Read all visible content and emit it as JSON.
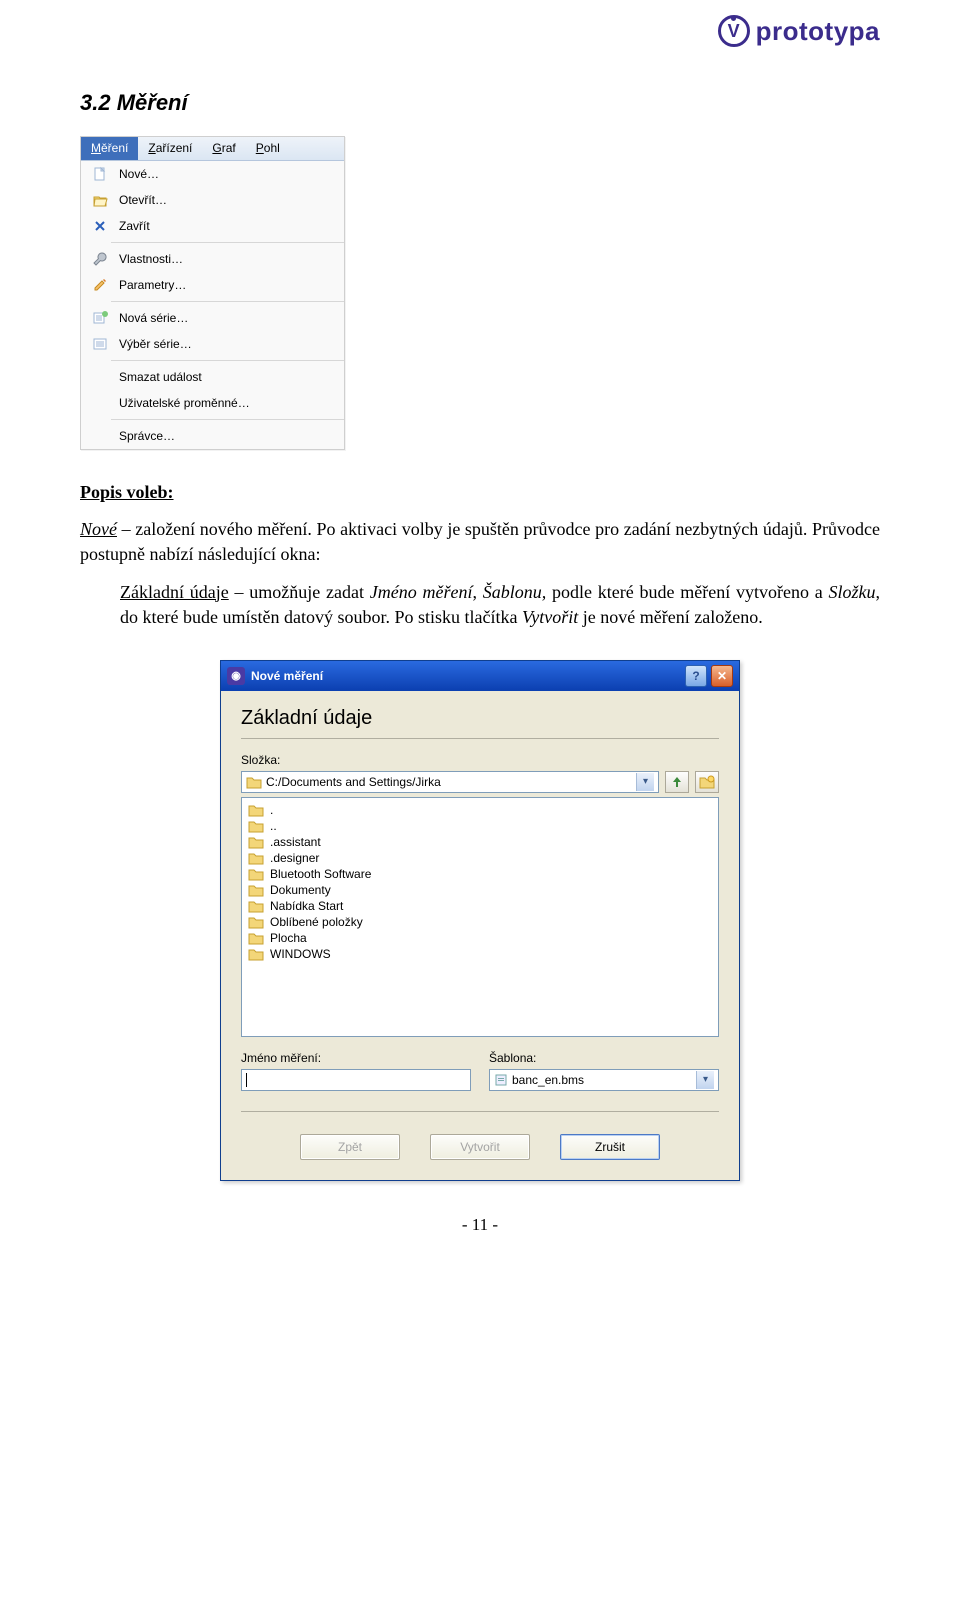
{
  "brand": {
    "name": "prototypa"
  },
  "section_heading": "3.2 Měření",
  "menu": {
    "bar": [
      {
        "label": "Měření",
        "u": "M",
        "active": true
      },
      {
        "label": "Zařízení",
        "u": "Z"
      },
      {
        "label": "Graf",
        "u": "G"
      },
      {
        "label": "Pohl",
        "u": "P"
      }
    ],
    "groups": [
      [
        {
          "label": "Nové…",
          "icon": "document-icon"
        },
        {
          "label": "Otevřít…",
          "icon": "open-folder-icon"
        },
        {
          "label": "Zavřít",
          "icon": "close-x-icon"
        }
      ],
      [
        {
          "label": "Vlastnosti…",
          "icon": "wrench-icon"
        },
        {
          "label": "Parametry…",
          "icon": "edit-icon"
        }
      ],
      [
        {
          "label": "Nová série…",
          "icon": "list-add-icon"
        },
        {
          "label": "Výběr série…",
          "icon": "list-icon"
        }
      ],
      [
        {
          "label": "Smazat událost",
          "icon": ""
        },
        {
          "label": "Uživatelské proměnné…",
          "icon": ""
        }
      ],
      [
        {
          "label": "Správce…",
          "icon": ""
        }
      ]
    ]
  },
  "text": {
    "popis_voleb": "Popis voleb:",
    "para1_lead": "Nové",
    "para1_rest": " – založení nového měření. Po aktivaci volby je spuštěn průvodce pro zadání nezbytných údajů. Průvodce postupně nabízí následující okna:",
    "para2_lead": "Základní údaje",
    "para2_rest": " – umožňuje zadat Jméno měření, Šablonu, podle které bude měření vytvořeno a Složku, do které bude umístěn datový soubor. Po stisku tlačítka Vytvořit je nové měření založeno.",
    "para2_em1": "Jméno měření",
    "para2_em2": "Šablonu,",
    "para2_em3": "Složku",
    "para2_em4": "Vytvořit"
  },
  "dialog": {
    "title": "Nové měření",
    "section": "Základní údaje",
    "folder_label": "Složka:",
    "folder_path": "C:/Documents and Settings/Jirka",
    "folder_list": [
      ".",
      "..",
      ".assistant",
      ".designer",
      "Bluetooth Software",
      "Dokumenty",
      "Nabídka Start",
      "Oblíbené položky",
      "Plocha",
      "WINDOWS"
    ],
    "name_label": "Jméno měření:",
    "name_value": "",
    "template_label": "Šablona:",
    "template_value": "banc_en.bms",
    "buttons": {
      "back": "Zpět",
      "create": "Vytvořit",
      "cancel": "Zrušit"
    }
  },
  "page_number": "- 11 -"
}
